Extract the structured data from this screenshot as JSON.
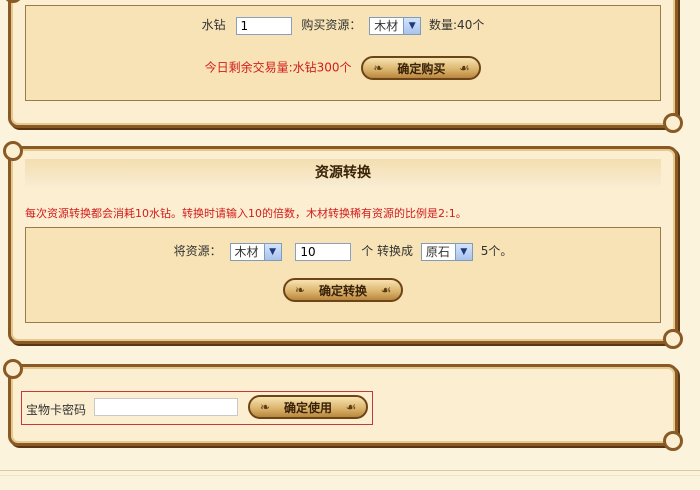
{
  "purchase": {
    "diamond_label": "水钻",
    "diamond_value": "1",
    "resource_label": "购买资源：",
    "resource_selected": "木材",
    "quantity_text": "数量:40个",
    "today_remaining": "今日剩余交易量:水钻300个",
    "confirm_label": "确定购买"
  },
  "convert": {
    "title": "资源转换",
    "notice": "每次资源转换都会消耗10水钻。转换时请输入10的倍数，木材转换稀有资源的比例是2:1。",
    "from_label": "将资源：",
    "from_selected": "木材",
    "amount_value": "10",
    "unit_to_label": "个 转换成",
    "to_selected": "原石",
    "result_text": "5个。",
    "confirm_label": "确定转换"
  },
  "card": {
    "password_label": "宝物卡密码",
    "password_value": "",
    "confirm_label": "确定使用"
  },
  "colors": {
    "accent_red": "#d21c1c",
    "panel_border": "#8a5a26",
    "panel_bg": "#fbeed1"
  }
}
